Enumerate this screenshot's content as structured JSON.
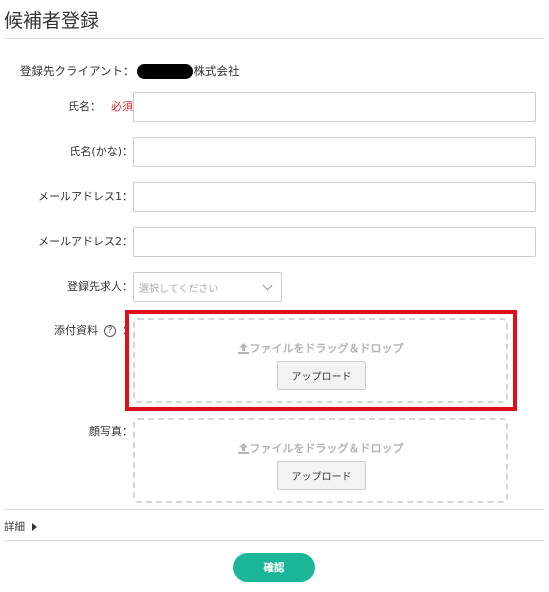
{
  "page": {
    "title": "候補者登録"
  },
  "client": {
    "label": "登録先クライアント：",
    "suffix": "株式会社"
  },
  "fields": {
    "name": {
      "label": "氏名：",
      "required": "必須",
      "value": ""
    },
    "name_kana": {
      "label": "氏名(かな)：",
      "value": ""
    },
    "email1": {
      "label": "メールアドレス1：",
      "value": ""
    },
    "email2": {
      "label": "メールアドレス2：",
      "value": ""
    },
    "job": {
      "label": "登録先求人：",
      "placeholder": "選択してください"
    },
    "attachment": {
      "label": "添付資料",
      "help_icon": "?",
      "colon": "：",
      "drop_text": "ファイルをドラッグ＆ドロップ",
      "upload_label": "アップロード"
    },
    "photo": {
      "label": "顔写真：",
      "drop_text": "ファイルをドラッグ＆ドロップ",
      "upload_label": "アップロード"
    }
  },
  "details": {
    "label": "詳細"
  },
  "actions": {
    "confirm_label": "確認"
  },
  "colors": {
    "accent": "#1bb597",
    "required": "#d0312d",
    "highlight": "#e0101b"
  }
}
